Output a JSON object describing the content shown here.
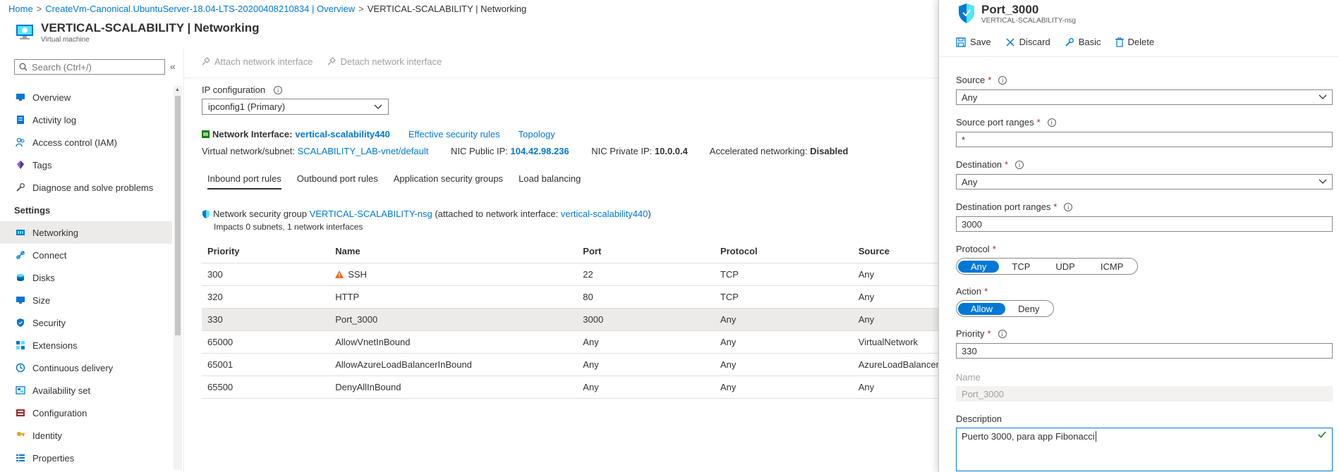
{
  "breadcrumb": {
    "home": "Home",
    "parent": "CreateVm-Canonical.UbuntuServer-18.04-LTS-20200408210834 | Overview",
    "current": "VERTICAL-SCALABILITY | Networking"
  },
  "header": {
    "title": "VERTICAL-SCALABILITY | Networking",
    "subtitle": "Virtual machine"
  },
  "nav": {
    "search_placeholder": "Search (Ctrl+/)",
    "collapse": "«",
    "items": [
      {
        "label": "Overview",
        "icon": "monitor-icon"
      },
      {
        "label": "Activity log",
        "icon": "log-icon"
      },
      {
        "label": "Access control (IAM)",
        "icon": "people-icon"
      },
      {
        "label": "Tags",
        "icon": "tag-icon"
      },
      {
        "label": "Diagnose and solve problems",
        "icon": "wrench-icon"
      }
    ],
    "settings_header": "Settings",
    "settings_items": [
      {
        "label": "Networking",
        "icon": "network-icon"
      },
      {
        "label": "Connect",
        "icon": "connect-icon"
      },
      {
        "label": "Disks",
        "icon": "disk-icon"
      },
      {
        "label": "Size",
        "icon": "size-icon"
      },
      {
        "label": "Security",
        "icon": "shield-icon"
      },
      {
        "label": "Extensions",
        "icon": "extensions-icon"
      },
      {
        "label": "Continuous delivery",
        "icon": "delivery-icon"
      },
      {
        "label": "Availability set",
        "icon": "availability-icon"
      },
      {
        "label": "Configuration",
        "icon": "config-icon"
      },
      {
        "label": "Identity",
        "icon": "identity-icon"
      },
      {
        "label": "Properties",
        "icon": "properties-icon"
      }
    ]
  },
  "toolbar": {
    "attach": "Attach network interface",
    "detach": "Detach network interface"
  },
  "ip_config": {
    "label": "IP configuration",
    "value": "ipconfig1 (Primary)"
  },
  "network_interface": {
    "label": "Network Interface:",
    "name": "vertical-scalability440",
    "effective_rules": "Effective security rules",
    "topology": "Topology"
  },
  "info": {
    "vnet_label": "Virtual network/subnet:",
    "vnet_value": "SCALABILITY_LAB-vnet/default",
    "public_ip_label": "NIC Public IP:",
    "public_ip_value": "104.42.98.236",
    "private_ip_label": "NIC Private IP:",
    "private_ip_value": "10.0.0.4",
    "accel_label": "Accelerated networking:",
    "accel_value": "Disabled"
  },
  "tabs": [
    "Inbound port rules",
    "Outbound port rules",
    "Application security groups",
    "Load balancing"
  ],
  "nsg": {
    "prefix": "Network security group",
    "name": "VERTICAL-SCALABILITY-nsg",
    "middle": "(attached to network interface:",
    "nic": "vertical-scalability440",
    "suffix": ")",
    "impacts": "Impacts 0 subnets, 1 network interfaces"
  },
  "rules": {
    "columns": [
      "Priority",
      "Name",
      "Port",
      "Protocol",
      "Source"
    ],
    "rows": [
      {
        "priority": "300",
        "name": "SSH",
        "port": "22",
        "protocol": "TCP",
        "source": "Any",
        "warn": true
      },
      {
        "priority": "320",
        "name": "HTTP",
        "port": "80",
        "protocol": "TCP",
        "source": "Any",
        "warn": false
      },
      {
        "priority": "330",
        "name": "Port_3000",
        "port": "3000",
        "protocol": "Any",
        "source": "Any",
        "warn": false
      },
      {
        "priority": "65000",
        "name": "AllowVnetInBound",
        "port": "Any",
        "protocol": "Any",
        "source": "VirtualNetwork",
        "warn": false
      },
      {
        "priority": "65001",
        "name": "AllowAzureLoadBalancerInBound",
        "port": "Any",
        "protocol": "Any",
        "source": "AzureLoadBalancer",
        "warn": false
      },
      {
        "priority": "65500",
        "name": "DenyAllInBound",
        "port": "Any",
        "protocol": "Any",
        "source": "Any",
        "warn": false
      }
    ]
  },
  "blade": {
    "title": "Port_3000",
    "subtitle": "VERTICAL-SCALABILITY-nsg",
    "save": "Save",
    "discard": "Discard",
    "basic": "Basic",
    "delete": "Delete",
    "source_label": "Source",
    "source_value": "Any",
    "source_ports_label": "Source port ranges",
    "source_ports_value": "*",
    "destination_label": "Destination",
    "destination_value": "Any",
    "dest_ports_label": "Destination port ranges",
    "dest_ports_value": "3000",
    "protocol_label": "Protocol",
    "protocol_options": [
      "Any",
      "TCP",
      "UDP",
      "ICMP"
    ],
    "action_label": "Action",
    "action_options": [
      "Allow",
      "Deny"
    ],
    "priority_label": "Priority",
    "priority_value": "330",
    "name_label": "Name",
    "name_value": "Port_3000",
    "description_label": "Description",
    "description_value": "Puerto 3000, para app Fibonacci",
    "required_mark": "*"
  }
}
